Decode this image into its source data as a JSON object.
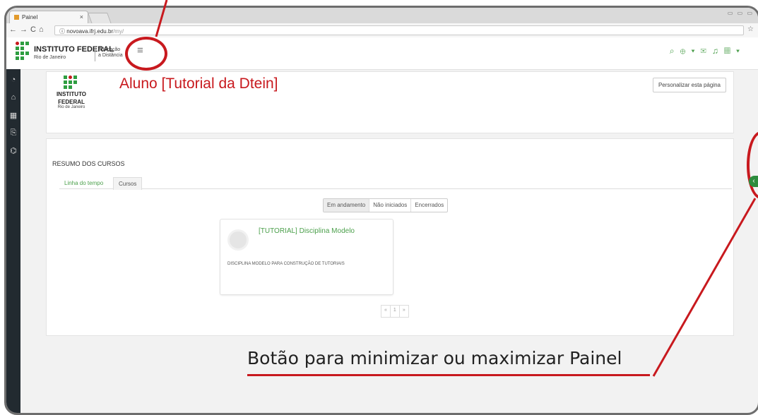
{
  "browser": {
    "tab_title": "Painel",
    "url_host": "novoava.ifrj.edu.br",
    "url_path": "/my/"
  },
  "header": {
    "brand": "INSTITUTO FEDERAL",
    "brand_sub": "Rio de Janeiro",
    "ead_line1": "Educação",
    "ead_line2": "a Distância"
  },
  "profile": {
    "logo_line1": "INSTITUTO",
    "logo_line2": "FEDERAL",
    "logo_line3": "Rio de Janeiro",
    "name": "Aluno [Tutorial da Dtein]",
    "customize_button": "Personalizar esta página"
  },
  "summary": {
    "title": "RESUMO DOS CURSOS",
    "tabs": [
      "Linha do tempo",
      "Cursos"
    ],
    "filters": [
      "Em andamento",
      "Não iniciados",
      "Encerrados"
    ],
    "course": {
      "title": "[TUTORIAL] Disciplina Modelo",
      "description": "DISCIPLINA MODELO PARA CONSTRUÇÃO DE TUTORIAIS"
    },
    "pager": [
      "«",
      "1",
      "»"
    ]
  },
  "annotation": {
    "callout": "Botão para minimizar ou maximizar Painel"
  },
  "colors": {
    "brand_green": "#2f9e41",
    "brand_red": "#c8191e",
    "sidebar": "#222a30"
  }
}
